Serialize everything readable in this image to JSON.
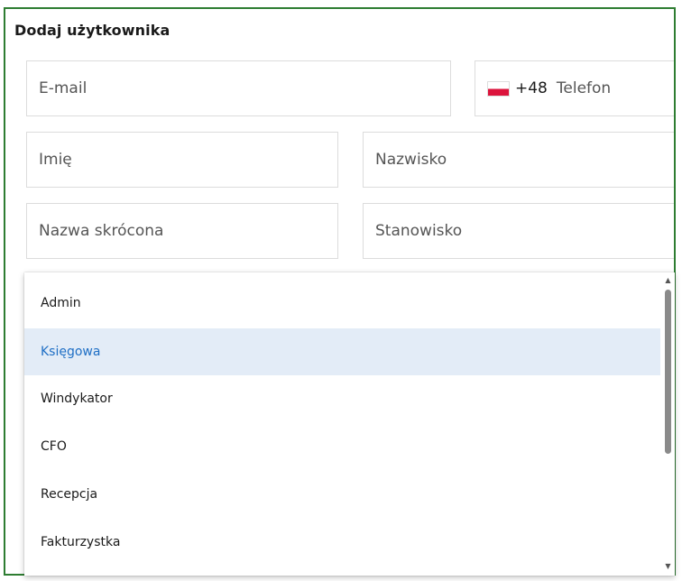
{
  "dialog": {
    "title": "Dodaj użytkownika"
  },
  "fields": {
    "email": {
      "placeholder": "E-mail"
    },
    "phone": {
      "country_code": "+48",
      "placeholder": "Telefon",
      "flag": "poland-flag-icon"
    },
    "first_name": {
      "placeholder": "Imię"
    },
    "last_name": {
      "placeholder": "Nazwisko"
    },
    "short_name": {
      "placeholder": "Nazwa skrócona"
    },
    "position": {
      "placeholder": "Stanowisko"
    }
  },
  "role_dropdown": {
    "options": [
      "Admin",
      "Księgowa",
      "Windykator",
      "CFO",
      "Recepcja",
      "Fakturzystka"
    ],
    "highlighted": "Księgowa"
  },
  "colors": {
    "border": "#2e7d32",
    "highlight_bg": "#e3ecf7",
    "highlight_text": "#1f6fc5"
  }
}
